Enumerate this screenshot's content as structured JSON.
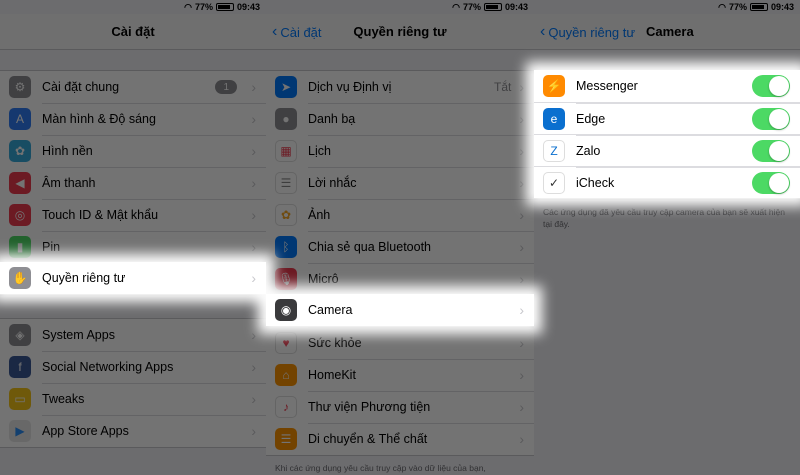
{
  "status": {
    "battery": "77%",
    "time": "09:43"
  },
  "panel1": {
    "title": "Cài đặt",
    "group1": [
      {
        "label": "Cài đặt chung",
        "icon": "gear-icon",
        "color": "#8e8e93",
        "badge": "1"
      },
      {
        "label": "Màn hình & Độ sáng",
        "icon": "display-icon",
        "color": "#2f7cf6"
      },
      {
        "label": "Hình nền",
        "icon": "wallpaper-icon",
        "color": "#35aadc"
      },
      {
        "label": "Âm thanh",
        "icon": "sound-icon",
        "color": "#f03a4f"
      },
      {
        "label": "Touch ID & Mật khẩu",
        "icon": "fingerprint-icon",
        "color": "#f03a4f"
      },
      {
        "label": "Pin",
        "icon": "battery-icon",
        "color": "#4cd964"
      },
      {
        "label": "Quyền riêng tư",
        "icon": "hand-icon",
        "color": "#8e8e93"
      }
    ],
    "group2": [
      {
        "label": "System Apps",
        "icon": "apps-icon",
        "color": "#8e8e93"
      },
      {
        "label": "Social Networking Apps",
        "icon": "facebook-icon",
        "color": "#3b5998"
      },
      {
        "label": "Tweaks",
        "icon": "tweaks-icon",
        "color": "#f5c518"
      },
      {
        "label": "App Store Apps",
        "icon": "appstore-icon",
        "color": "#e6e6e6"
      }
    ]
  },
  "panel2": {
    "back": "Cài đặt",
    "title": "Quyền riêng tư",
    "items": [
      {
        "label": "Dịch vụ Định vị",
        "detail": "Tắt",
        "icon": "location-icon",
        "color": "#007aff"
      },
      {
        "label": "Danh bạ",
        "icon": "contacts-icon",
        "color": "#8e8e93"
      },
      {
        "label": "Lịch",
        "icon": "calendar-icon",
        "color": "#ffffff"
      },
      {
        "label": "Lời nhắc",
        "icon": "reminders-icon",
        "color": "#ffffff"
      },
      {
        "label": "Ảnh",
        "icon": "photos-icon",
        "color": "#ffffff"
      },
      {
        "label": "Chia sẻ qua Bluetooth",
        "icon": "bluetooth-icon",
        "color": "#007aff"
      },
      {
        "label": "Micrô",
        "icon": "microphone-icon",
        "color": "#f03a4f"
      },
      {
        "label": "Camera",
        "icon": "camera-icon",
        "color": "#3a3a3c"
      },
      {
        "label": "Sức khỏe",
        "icon": "health-icon",
        "color": "#ffffff"
      },
      {
        "label": "HomeKit",
        "icon": "home-icon",
        "color": "#ff9500"
      },
      {
        "label": "Thư viện Phương tiện",
        "icon": "music-icon",
        "color": "#ffffff"
      },
      {
        "label": "Di chuyển & Thể chất",
        "icon": "motion-icon",
        "color": "#ff9500"
      }
    ],
    "footer": "Khi các ứng dụng yêu cầu truy cập vào dữ liệu của bạn,"
  },
  "panel3": {
    "back": "Quyền riêng tư",
    "title": "Camera",
    "apps": [
      {
        "label": "Messenger",
        "icon": "messenger-icon",
        "color": "#ff8a00",
        "on": true
      },
      {
        "label": "Edge",
        "icon": "edge-icon",
        "color": "#0a6fcf",
        "on": true
      },
      {
        "label": "Zalo",
        "icon": "zalo-icon",
        "color": "#ffffff",
        "on": true
      },
      {
        "label": "iCheck",
        "icon": "icheck-icon",
        "color": "#ffffff",
        "on": true
      }
    ],
    "toggle_color": "#4cd964",
    "footer": "Các ứng dụng đã yêu cầu truy cập camera của bạn sẽ xuất hiện tại đây."
  }
}
